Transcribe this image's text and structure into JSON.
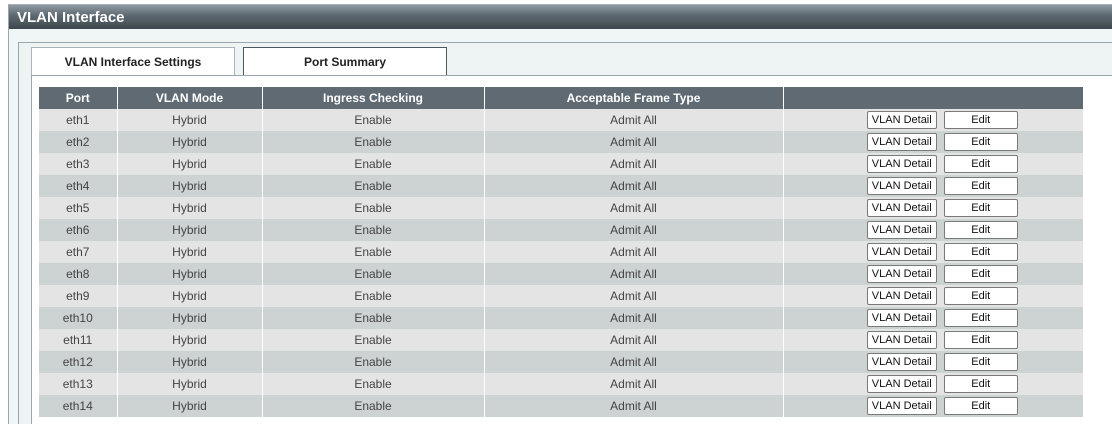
{
  "window": {
    "title": "VLAN Interface"
  },
  "tabs": [
    {
      "label": "VLAN Interface Settings",
      "active": true
    },
    {
      "label": "Port Summary",
      "active": false
    }
  ],
  "table": {
    "headers": [
      "Port",
      "VLAN Mode",
      "Ingress Checking",
      "Acceptable Frame Type",
      ""
    ],
    "detail_label": "VLAN Detail",
    "edit_label": "Edit",
    "rows": [
      {
        "port": "eth1",
        "mode": "Hybrid",
        "ingress": "Enable",
        "frame": "Admit All"
      },
      {
        "port": "eth2",
        "mode": "Hybrid",
        "ingress": "Enable",
        "frame": "Admit All"
      },
      {
        "port": "eth3",
        "mode": "Hybrid",
        "ingress": "Enable",
        "frame": "Admit All"
      },
      {
        "port": "eth4",
        "mode": "Hybrid",
        "ingress": "Enable",
        "frame": "Admit All"
      },
      {
        "port": "eth5",
        "mode": "Hybrid",
        "ingress": "Enable",
        "frame": "Admit All"
      },
      {
        "port": "eth6",
        "mode": "Hybrid",
        "ingress": "Enable",
        "frame": "Admit All"
      },
      {
        "port": "eth7",
        "mode": "Hybrid",
        "ingress": "Enable",
        "frame": "Admit All"
      },
      {
        "port": "eth8",
        "mode": "Hybrid",
        "ingress": "Enable",
        "frame": "Admit All"
      },
      {
        "port": "eth9",
        "mode": "Hybrid",
        "ingress": "Enable",
        "frame": "Admit All"
      },
      {
        "port": "eth10",
        "mode": "Hybrid",
        "ingress": "Enable",
        "frame": "Admit All"
      },
      {
        "port": "eth11",
        "mode": "Hybrid",
        "ingress": "Enable",
        "frame": "Admit All"
      },
      {
        "port": "eth12",
        "mode": "Hybrid",
        "ingress": "Enable",
        "frame": "Admit All"
      },
      {
        "port": "eth13",
        "mode": "Hybrid",
        "ingress": "Enable",
        "frame": "Admit All"
      },
      {
        "port": "eth14",
        "mode": "Hybrid",
        "ingress": "Enable",
        "frame": "Admit All"
      }
    ]
  },
  "colors": {
    "header_bg": "#5f6a72",
    "row_odd": "#e4e4e4",
    "row_even": "#cdd2d2",
    "panel_bg": "#eef4f4"
  }
}
